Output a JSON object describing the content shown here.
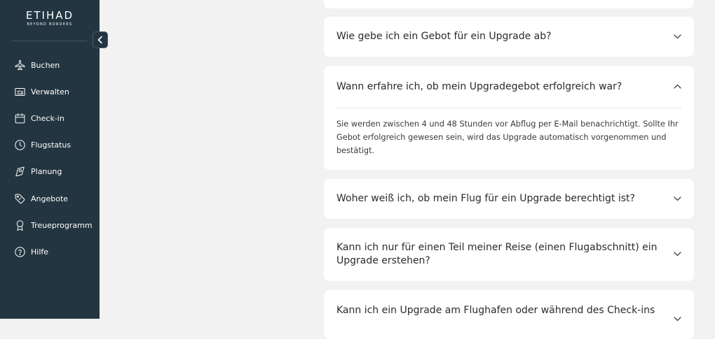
{
  "brand": {
    "name": "ETIHAD",
    "tagline": "BEYOND BORDERS"
  },
  "colors": {
    "sidebar": "#233540",
    "page": "#f2f2f2",
    "card": "#ffffff"
  },
  "nav": [
    {
      "label": "Buchen",
      "icon": "plane-icon"
    },
    {
      "label": "Verwalten",
      "icon": "ticket-icon"
    },
    {
      "label": "Check-in",
      "icon": "calendar-icon"
    },
    {
      "label": "Flugstatus",
      "icon": "clock-icon"
    },
    {
      "label": "Planung",
      "icon": "map-pin-icon"
    },
    {
      "label": "Angebote",
      "icon": "tag-icon"
    },
    {
      "label": "Treueprogramm",
      "icon": "award-icon"
    },
    {
      "label": "Hilfe",
      "icon": "help-icon"
    }
  ],
  "faq": [
    {
      "question": "Wie gebe ich ein Gebot für ein Upgrade ab?",
      "expanded": false
    },
    {
      "question": "Wann erfahre ich, ob mein Upgradegebot erfolgreich war?",
      "expanded": true,
      "answer": "Sie werden zwischen 4 und 48 Stunden vor Abflug per E-Mail benachrichtigt. Sollte Ihr Gebot erfolgreich gewesen sein, wird das Upgrade automatisch vorgenommen und bestätigt."
    },
    {
      "question": "Woher weiß ich, ob mein Flug für ein Upgrade berechtigt ist?",
      "expanded": false
    },
    {
      "question": "Kann ich nur für einen Teil meiner Reise (einen Flugabschnitt) ein Upgrade erstehen?",
      "expanded": false
    },
    {
      "question": "Kann ich ein Upgrade am Flughafen oder während des Check-ins",
      "expanded": false
    }
  ]
}
